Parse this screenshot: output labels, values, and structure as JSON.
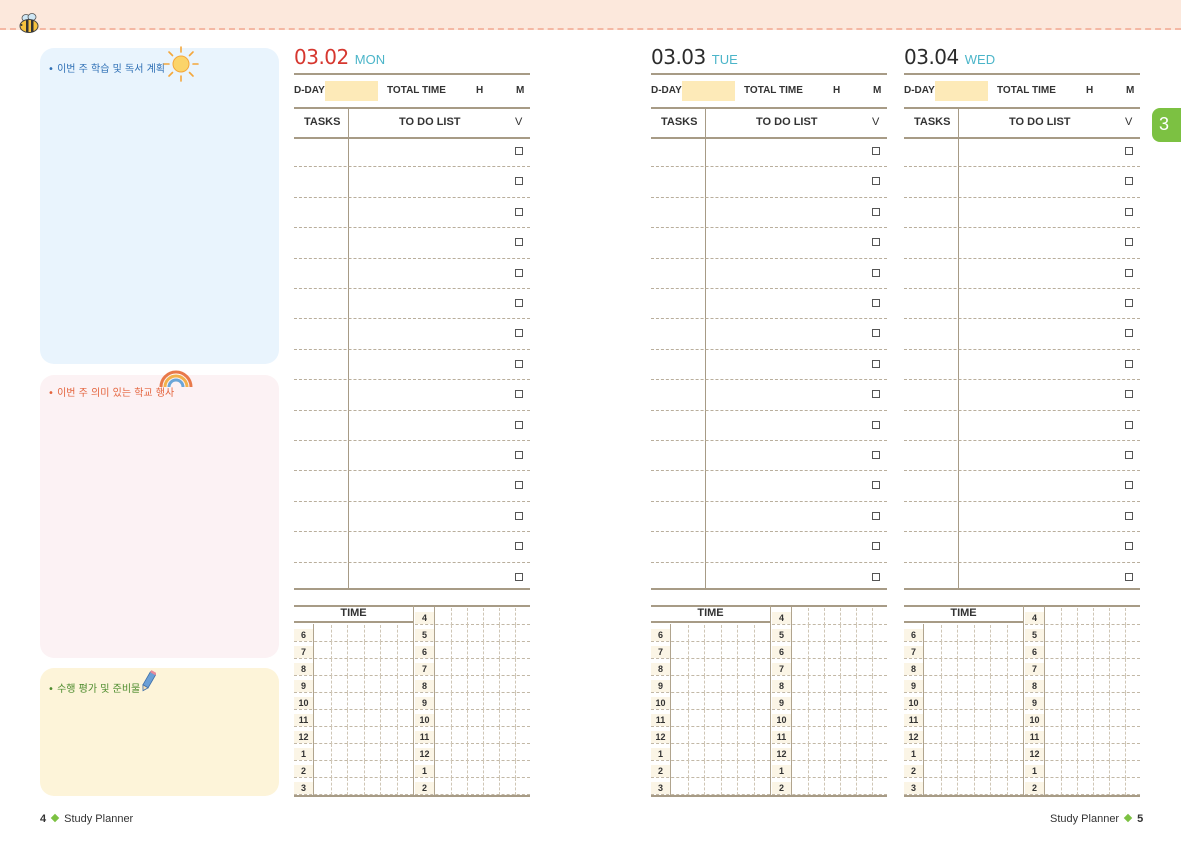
{
  "colors": {
    "monday_date": "#d6372f",
    "other_date": "#2b2b2b",
    "weekday": "#4bb5c9",
    "tab": "#7cc142"
  },
  "left_panels": [
    {
      "title": "• 이번 주 학습 및 독서 계획",
      "icon": "sun-icon"
    },
    {
      "title": "• 이번 주 의미 있는 학교 행사",
      "icon": "rainbow-icon"
    },
    {
      "title": "• 수행 평가 및 준비물",
      "icon": "pencil-icon"
    }
  ],
  "days": [
    {
      "date": "03.02",
      "weekday": "MON"
    },
    {
      "date": "03.03",
      "weekday": "TUE"
    },
    {
      "date": "03.04",
      "weekday": "WED"
    }
  ],
  "labels": {
    "dday": "D-DAY",
    "total_time": "TOTAL TIME",
    "hours": "H",
    "minutes": "M",
    "tasks": "TASKS",
    "todo": "TO DO LIST",
    "check": "V",
    "time": "TIME"
  },
  "time_grid": {
    "left_hours": [
      "6",
      "7",
      "8",
      "9",
      "10",
      "11",
      "12",
      "1",
      "2",
      "3"
    ],
    "right_hours": [
      "4",
      "5",
      "6",
      "7",
      "8",
      "9",
      "10",
      "11",
      "12",
      "1",
      "2"
    ]
  },
  "tab": {
    "number": "3"
  },
  "footer": {
    "left_page": "4",
    "left_title": "Study Planner",
    "right_title": "Study Planner",
    "right_page": "5"
  }
}
